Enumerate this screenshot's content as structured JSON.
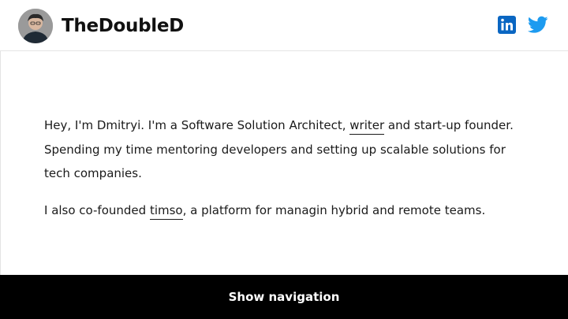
{
  "header": {
    "site_title": "TheDoubleD",
    "social": [
      {
        "name": "linkedin",
        "icon": "linkedin-icon",
        "color": "#0a66c2"
      },
      {
        "name": "twitter",
        "icon": "twitter-icon",
        "color": "#1d9bf0"
      }
    ]
  },
  "intro": {
    "p1_before": "Hey, I'm Dmitryi. I'm a Software Solution Architect, ",
    "p1_link": "writer",
    "p1_after": " and start-up founder. Spending my time mentoring developers and setting up scalable solutions for tech companies.",
    "p2_before": "I also co-founded ",
    "p2_link": "timso",
    "p2_after": ", a platform for managin hybrid and remote teams."
  },
  "footer": {
    "nav_label": "Show navigation"
  }
}
